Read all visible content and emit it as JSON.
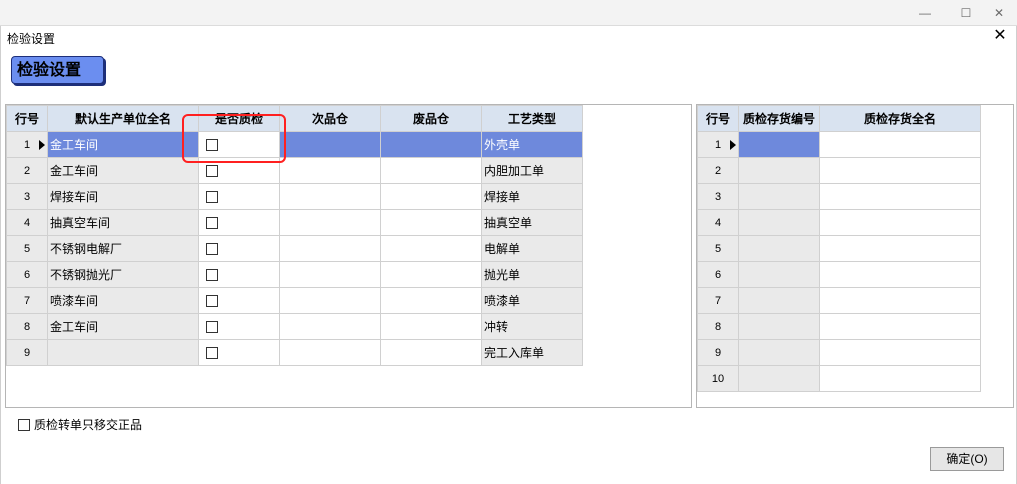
{
  "window": {
    "minimize_glyph": "—",
    "maximize_glyph": "☐",
    "close_glyph": "✕"
  },
  "dialog": {
    "title": "检验设置",
    "close_glyph": "✕",
    "badge": "检验设置"
  },
  "left_grid": {
    "columns": [
      "行号",
      "默认生产单位全名",
      "是否质检",
      "次品仓",
      "废品仓",
      "工艺类型"
    ],
    "selected_row": 1,
    "rows": [
      {
        "num": "1",
        "unit": "金工车间",
        "inspect": false,
        "defect": "",
        "waste": "",
        "process": "外壳单"
      },
      {
        "num": "2",
        "unit": "金工车间",
        "inspect": false,
        "defect": "",
        "waste": "",
        "process": "内胆加工单"
      },
      {
        "num": "3",
        "unit": "焊接车间",
        "inspect": false,
        "defect": "",
        "waste": "",
        "process": "焊接单"
      },
      {
        "num": "4",
        "unit": "抽真空车间",
        "inspect": false,
        "defect": "",
        "waste": "",
        "process": "抽真空单"
      },
      {
        "num": "5",
        "unit": "不锈钢电解厂",
        "inspect": false,
        "defect": "",
        "waste": "",
        "process": "电解单"
      },
      {
        "num": "6",
        "unit": "不锈钢抛光厂",
        "inspect": false,
        "defect": "",
        "waste": "",
        "process": "抛光单"
      },
      {
        "num": "7",
        "unit": "喷漆车间",
        "inspect": false,
        "defect": "",
        "waste": "",
        "process": "喷漆单"
      },
      {
        "num": "8",
        "unit": "金工车间",
        "inspect": false,
        "defect": "",
        "waste": "",
        "process": "冲转"
      },
      {
        "num": "9",
        "unit": "",
        "inspect": false,
        "defect": "",
        "waste": "",
        "process": "完工入库单"
      }
    ]
  },
  "right_grid": {
    "columns": [
      "行号",
      "质检存货编号",
      "质检存货全名"
    ],
    "selected_row": 1,
    "rows": [
      {
        "num": "1",
        "code": "",
        "name": ""
      },
      {
        "num": "2",
        "code": "",
        "name": ""
      },
      {
        "num": "3",
        "code": "",
        "name": ""
      },
      {
        "num": "4",
        "code": "",
        "name": ""
      },
      {
        "num": "5",
        "code": "",
        "name": ""
      },
      {
        "num": "6",
        "code": "",
        "name": ""
      },
      {
        "num": "7",
        "code": "",
        "name": ""
      },
      {
        "num": "8",
        "code": "",
        "name": ""
      },
      {
        "num": "9",
        "code": "",
        "name": ""
      },
      {
        "num": "10",
        "code": "",
        "name": ""
      }
    ]
  },
  "footer": {
    "transfer_checkbox_label": "质检转单只移交正品",
    "transfer_checked": false,
    "ok_button": "确定(O)"
  },
  "colors": {
    "selection": "#6e89dc",
    "header": "#d9e3f0",
    "highlight": "#ff2020",
    "badge": "#6b8ef0"
  }
}
